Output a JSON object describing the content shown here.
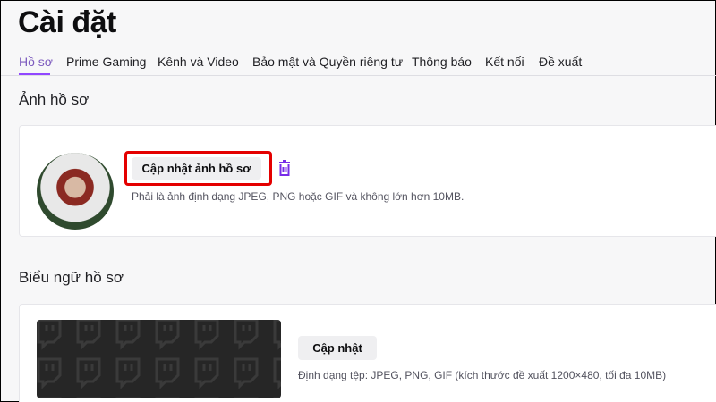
{
  "header": {
    "title": "Cài đặt"
  },
  "tabs": [
    {
      "label": "Hồ sơ",
      "active": true
    },
    {
      "label": "Prime Gaming"
    },
    {
      "label": "Kênh và Video"
    },
    {
      "label": "Bảo mật và Quyền riêng tư"
    },
    {
      "label": "Thông báo"
    },
    {
      "label": "Kết nối"
    },
    {
      "label": "Đề xuất"
    }
  ],
  "profile_picture": {
    "title": "Ảnh hồ sơ",
    "update_button": "Cập nhật ảnh hồ sơ",
    "hint": "Phải là ảnh định dạng JPEG, PNG hoặc GIF và không lớn hơn 10MB."
  },
  "profile_banner": {
    "title": "Biểu ngữ hồ sơ",
    "update_button": "Cập nhật",
    "hint": "Định dạng tệp: JPEG, PNG, GIF (kích thước đề xuất 1200×480, tối đa 10MB)"
  },
  "colors": {
    "accent": "#9147ff",
    "highlight": "#e40000",
    "background": "#f7f7f8"
  }
}
